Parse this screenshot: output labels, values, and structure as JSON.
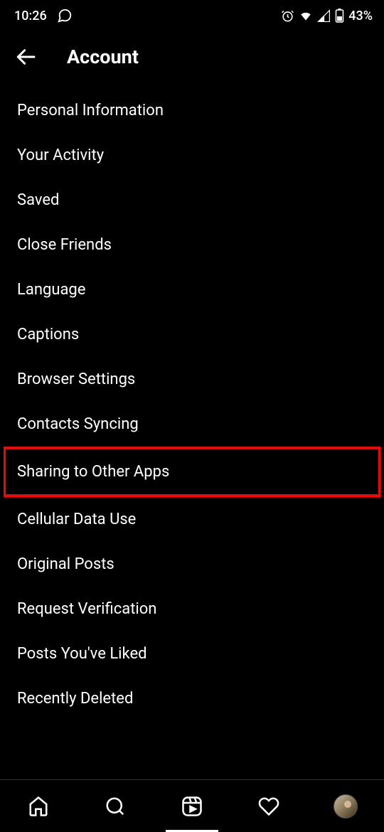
{
  "status_bar": {
    "time": "10:26",
    "battery_text": "43%"
  },
  "header": {
    "title": "Account"
  },
  "menu": {
    "items": [
      {
        "label": "Personal Information"
      },
      {
        "label": "Your Activity"
      },
      {
        "label": "Saved"
      },
      {
        "label": "Close Friends"
      },
      {
        "label": "Language"
      },
      {
        "label": "Captions"
      },
      {
        "label": "Browser Settings"
      },
      {
        "label": "Contacts Syncing"
      },
      {
        "label": "Sharing to Other Apps",
        "highlighted": true
      },
      {
        "label": "Cellular Data Use"
      },
      {
        "label": "Original Posts"
      },
      {
        "label": "Request Verification"
      },
      {
        "label": "Posts You've Liked"
      },
      {
        "label": "Recently Deleted"
      }
    ]
  }
}
